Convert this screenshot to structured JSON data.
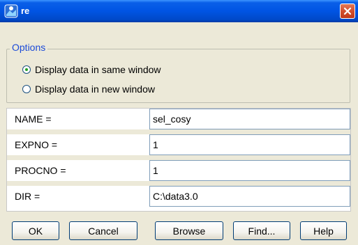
{
  "window": {
    "title": "re"
  },
  "options": {
    "legend": "Options",
    "radios": [
      {
        "label": "Display data in same window",
        "checked": true
      },
      {
        "label": "Display data in new window",
        "checked": false
      }
    ]
  },
  "fields": [
    {
      "label": "NAME =",
      "value": "sel_cosy"
    },
    {
      "label": "EXPNO =",
      "value": "1"
    },
    {
      "label": "PROCNO =",
      "value": "1"
    },
    {
      "label": "DIR =",
      "value": "C:\\data3.0"
    }
  ],
  "buttons": {
    "ok": "OK",
    "cancel": "Cancel",
    "browse": "Browse",
    "find": "Find...",
    "help": "Help"
  },
  "colors": {
    "titlebar": "#0054e3",
    "legend": "#1c4bd8",
    "close": "#d34f2e"
  },
  "icons": {
    "app": "topspin-app-icon",
    "close": "close-icon"
  }
}
